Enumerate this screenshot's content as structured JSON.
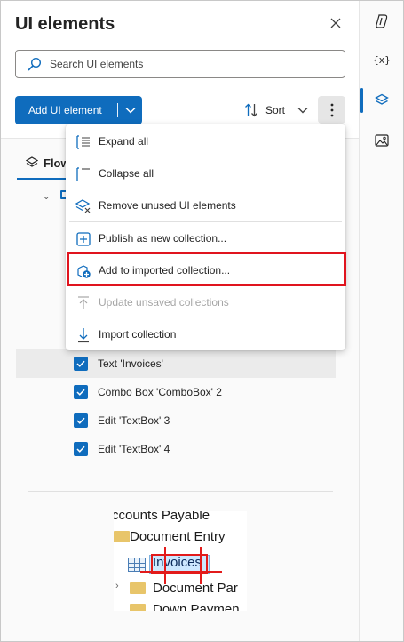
{
  "panel": {
    "title": "UI elements",
    "search_placeholder": "Search UI elements",
    "add_button_label": "Add UI element",
    "sort_label": "Sort",
    "tab_label": "Flow"
  },
  "menu": {
    "items": [
      {
        "label": "Expand all",
        "icon": "expand-all-icon",
        "disabled": false
      },
      {
        "label": "Collapse all",
        "icon": "collapse-all-icon",
        "disabled": false
      },
      {
        "label": "Remove unused UI elements",
        "icon": "remove-unused-icon",
        "disabled": false
      },
      {
        "label": "Publish as new collection...",
        "icon": "publish-collection-icon",
        "disabled": false
      },
      {
        "label": "Add to imported collection...",
        "icon": "add-to-collection-icon",
        "disabled": false,
        "highlighted": true
      },
      {
        "label": "Update unsaved collections",
        "icon": "update-collection-icon",
        "disabled": true
      },
      {
        "label": "Import collection",
        "icon": "import-collection-icon",
        "disabled": false
      }
    ]
  },
  "elements": [
    {
      "label": "Text 'Invoices'",
      "checked": true,
      "selected": true
    },
    {
      "label": "Combo Box 'ComboBox' 2",
      "checked": true,
      "selected": false
    },
    {
      "label": "Edit 'TextBox' 3",
      "checked": true,
      "selected": false
    },
    {
      "label": "Edit 'TextBox' 4",
      "checked": true,
      "selected": false
    }
  ],
  "preview": {
    "line1": "ccounts Payable",
    "line2": "Document Entry",
    "line3": "Invoices",
    "line4": "Document Par",
    "line5": "Down Paymen"
  },
  "rail": {
    "variables_label": "{x}"
  },
  "colors": {
    "accent": "#0f6cbd",
    "highlight_border": "#e0141e"
  }
}
